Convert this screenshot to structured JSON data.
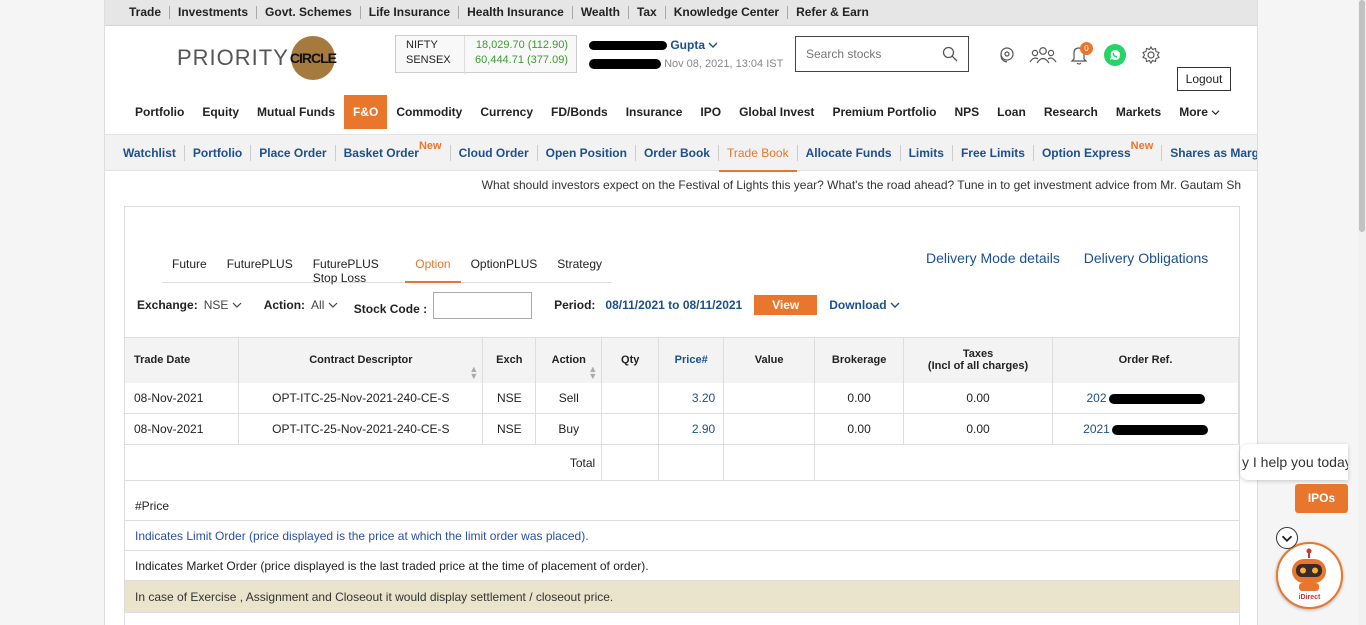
{
  "topstrip": [
    "Trade",
    "Investments",
    "Govt. Schemes",
    "Life Insurance",
    "Health Insurance",
    "Wealth",
    "Tax",
    "Knowledge Center",
    "Refer & Earn"
  ],
  "logo": {
    "text1": "PRIORITY",
    "text2": "CIRCLE"
  },
  "indices": [
    {
      "name": "NIFTY",
      "value": "18,029.70 (112.90)"
    },
    {
      "name": "SENSEX",
      "value": "60,444.71 (377.09)"
    }
  ],
  "user": {
    "name": "Gupta",
    "timestamp": "Nov 08, 2021, 13:04 IST"
  },
  "search": {
    "placeholder": "Search stocks"
  },
  "notifications_count": "0",
  "logout_label": "Logout",
  "mainnav": [
    "Portfolio",
    "Equity",
    "Mutual Funds",
    "F&O",
    "Commodity",
    "Currency",
    "FD/Bonds",
    "Insurance",
    "IPO",
    "Global Invest",
    "Premium Portfolio",
    "NPS",
    "Loan",
    "Research",
    "Markets",
    "More"
  ],
  "subnav": [
    "Watchlist",
    "Portfolio",
    "Place Order",
    "Basket Order",
    "Cloud Order",
    "Open Position",
    "Order Book",
    "Trade Book",
    "Allocate Funds",
    "Limits",
    "Free Limits",
    "Option Express",
    "Shares as Margin"
  ],
  "subnav_new_label": "New",
  "subnav_plus": "[ + ]",
  "ticker": "What should investors expect on the Festival of Lights this year? What's the road ahead? Tune in to get investment advice from Mr. Gautam Sh",
  "tabs": [
    "Future",
    "FuturePLUS",
    "FuturePLUS Stop Loss",
    "Option",
    "OptionPLUS",
    "Strategy"
  ],
  "delivery_links": [
    "Delivery Mode details",
    "Delivery Obligations"
  ],
  "filters": {
    "exchange_label": "Exchange:",
    "exchange_value": "NSE",
    "action_label": "Action:",
    "action_value": "All",
    "stock_label": "Stock Code :",
    "period_label": "Period:",
    "period_value": "08/11/2021 to 08/11/2021",
    "view_label": "View",
    "download_label": "Download"
  },
  "table": {
    "headers": [
      "Trade Date",
      "Contract Descriptor",
      "Exch",
      "Action",
      "Qty",
      "Price#",
      "Value",
      "Brokerage",
      "Taxes",
      "Order Ref."
    ],
    "taxes_sub": "(Incl of all charges)",
    "rows": [
      {
        "date": "08-Nov-2021",
        "contract": "OPT-ITC-25-Nov-2021-240-CE-S",
        "exch": "NSE",
        "action": "Sell",
        "price": "3.20",
        "brokerage": "0.00",
        "taxes": "0.00",
        "ref": "202"
      },
      {
        "date": "08-Nov-2021",
        "contract": "OPT-ITC-25-Nov-2021-240-CE-S",
        "exch": "NSE",
        "action": "Buy",
        "price": "2.90",
        "brokerage": "0.00",
        "taxes": "0.00",
        "ref": "2021"
      }
    ],
    "total_label": "Total"
  },
  "legend": {
    "price_note": "#Price",
    "limit": "Indicates Limit Order (price displayed is the price at which the limit order was placed).",
    "market": "Indicates Market Order (price displayed is the last traded price at the time of placement of order).",
    "exercise": "In case of Exercise , Assignment and Closeout it would display settlement / closeout price."
  },
  "chat": {
    "bubble": "y I help you today",
    "ipos": "IPOs",
    "bot_label": "iDirect"
  },
  "colors": {
    "accent": "#e8762d",
    "link": "#1d4f8c",
    "positive": "#3a9b2f"
  }
}
